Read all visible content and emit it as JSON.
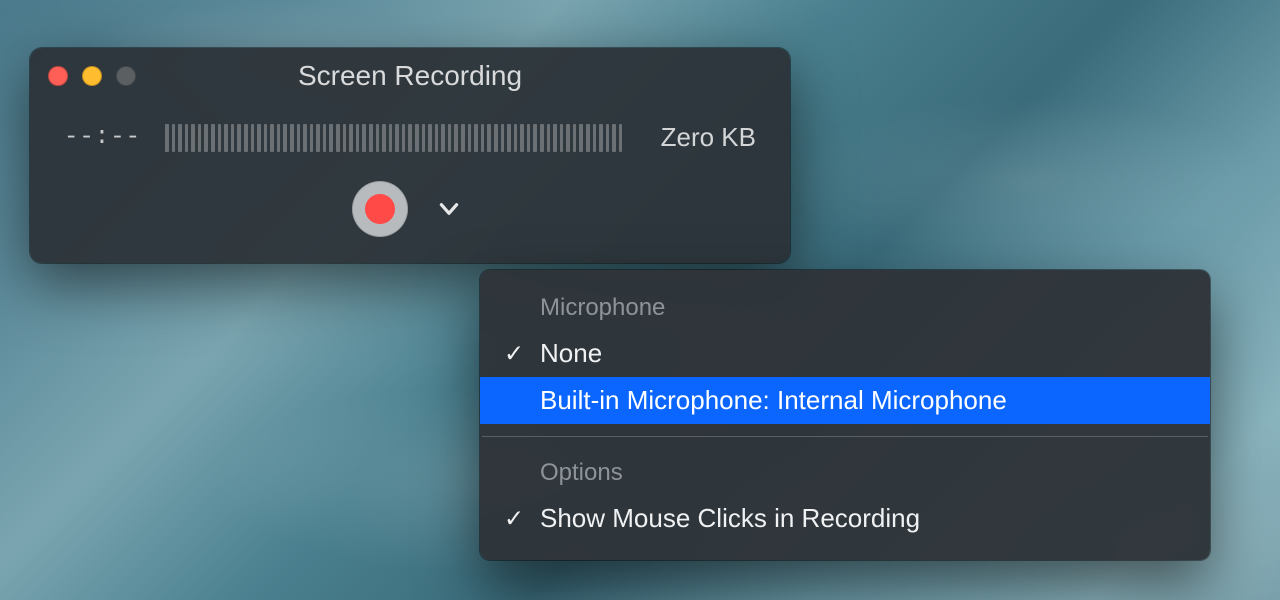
{
  "window": {
    "title": "Screen Recording",
    "time_display": "--:--",
    "file_size": "Zero KB"
  },
  "controls": {
    "record_label": "Record"
  },
  "menu": {
    "section_microphone": "Microphone",
    "items_microphone": [
      {
        "label": "None",
        "checked": true,
        "highlighted": false
      },
      {
        "label": "Built-in Microphone: Internal Microphone",
        "checked": false,
        "highlighted": true
      }
    ],
    "section_options": "Options",
    "items_options": [
      {
        "label": "Show Mouse Clicks in Recording",
        "checked": true,
        "highlighted": false
      }
    ]
  },
  "colors": {
    "window_bg": "#2c3237",
    "highlight": "#0a66ff",
    "record_red": "#ff4a47",
    "traffic_red": "#ff5f57",
    "traffic_yellow": "#febc2e"
  }
}
